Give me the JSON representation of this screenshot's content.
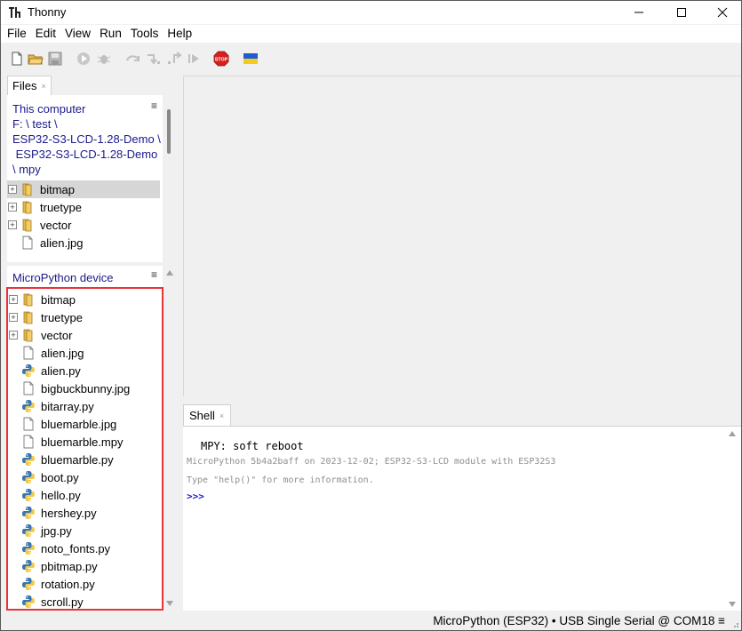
{
  "window": {
    "title": "Thonny"
  },
  "menu": [
    "File",
    "Edit",
    "View",
    "Run",
    "Tools",
    "Help"
  ],
  "toolbar": {
    "items": [
      "new-file-icon",
      "open-file-icon",
      "save-icon",
      "run-icon",
      "debug-icon",
      "step-over-icon",
      "step-into-icon",
      "step-out-icon",
      "resume-icon",
      "stop-icon",
      "ukraine-flag-icon"
    ],
    "stop_label": "STOP"
  },
  "files_tab": {
    "label": "Files",
    "close": "×"
  },
  "local": {
    "header": "This computer",
    "menu_glyph": "≡",
    "path_lines": [
      "F: \\ test \\",
      "ESP32-S3-LCD-1.28-Demo \\",
      " ESP32-S3-LCD-1.28-Demo",
      "\\ mpy"
    ],
    "items": [
      {
        "name": "bitmap",
        "type": "folder",
        "selected": true
      },
      {
        "name": "truetype",
        "type": "folder"
      },
      {
        "name": "vector",
        "type": "folder"
      },
      {
        "name": "alien.jpg",
        "type": "file"
      }
    ]
  },
  "device": {
    "header": "MicroPython device",
    "menu_glyph": "≡",
    "items": [
      {
        "name": "bitmap",
        "type": "folder"
      },
      {
        "name": "truetype",
        "type": "folder"
      },
      {
        "name": "vector",
        "type": "folder"
      },
      {
        "name": "alien.jpg",
        "type": "file"
      },
      {
        "name": "alien.py",
        "type": "python"
      },
      {
        "name": "bigbuckbunny.jpg",
        "type": "file"
      },
      {
        "name": "bitarray.py",
        "type": "python"
      },
      {
        "name": "bluemarble.jpg",
        "type": "file"
      },
      {
        "name": "bluemarble.mpy",
        "type": "file"
      },
      {
        "name": "bluemarble.py",
        "type": "python"
      },
      {
        "name": "boot.py",
        "type": "python"
      },
      {
        "name": "hello.py",
        "type": "python"
      },
      {
        "name": "hershey.py",
        "type": "python"
      },
      {
        "name": "jpg.py",
        "type": "python"
      },
      {
        "name": "noto_fonts.py",
        "type": "python"
      },
      {
        "name": "pbitmap.py",
        "type": "python"
      },
      {
        "name": "rotation.py",
        "type": "python"
      },
      {
        "name": "scroll.py",
        "type": "python"
      }
    ]
  },
  "shell": {
    "tab_label": "Shell",
    "close": "×",
    "lines": [
      "MPY: soft reboot",
      "MicroPython 5b4a2baff on 2023-12-02; ESP32-S3-LCD module with ESP32S3",
      "Type \"help()\" for more information.",
      ">>>"
    ]
  },
  "status": {
    "text": "MicroPython (ESP32)  •  USB Single Serial @ COM18  ≡"
  },
  "colors": {
    "highlight_border": "#e8333a",
    "path_text": "#1a1a8c",
    "prompt": "#1b1bd6"
  }
}
